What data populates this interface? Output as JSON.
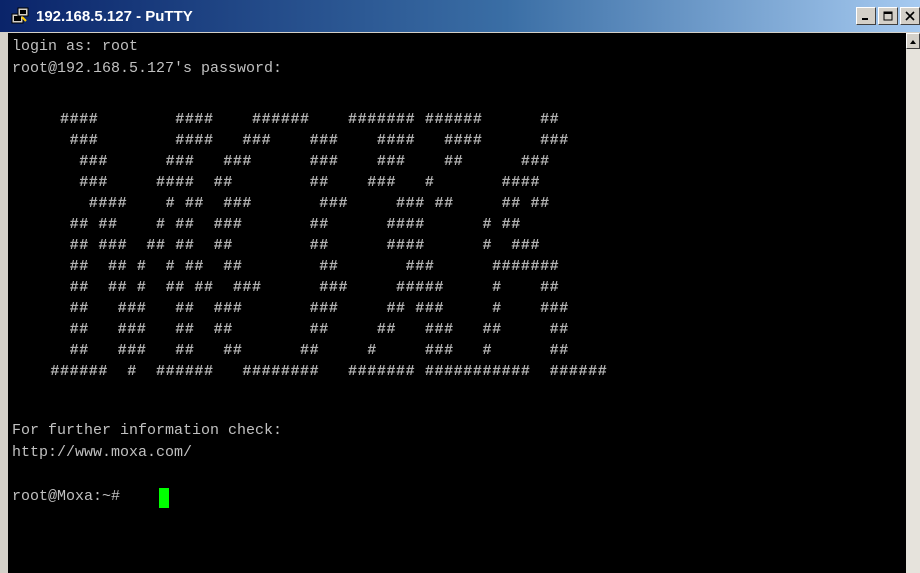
{
  "window": {
    "title": "192.168.5.127 - PuTTY",
    "controls": [
      "minimize",
      "maximize",
      "close"
    ]
  },
  "terminal": {
    "login_prompt": "login as: root",
    "password_prompt": "root@192.168.5.127's password:",
    "banner": "     ####        ####    ######    ####### ######      ##\n      ###        ####   ###    ###    ####   ####      ###\n       ###      ###   ###      ###    ###    ##      ###\n       ###     ####  ##        ##    ###   #       ####\n        ####    # ##  ###       ###     ### ##     ## ##\n      ## ##    # ##  ###       ##      ####      # ##\n      ## ###  ## ##  ##        ##      ####      #  ###\n      ##  ## #  # ##  ##        ##       ###      #######\n      ##  ## #  ## ##  ###      ###     #####     #    ##\n      ##   ###   ##  ###       ###     ## ###     #    ###\n      ##   ###   ##  ##        ##     ##   ###   ##     ##\n      ##   ###   ##   ##      ##     #     ###   #      ##\n    ######  #  ######   ########   ####### ###########  ######",
    "info_line": "For further information check:",
    "url_line": "http://www.moxa.com/",
    "shell_prompt": "root@Moxa:~#",
    "cursor_color": "#00ff00",
    "text_color": "#c0c0c0",
    "background_color": "#000000"
  }
}
